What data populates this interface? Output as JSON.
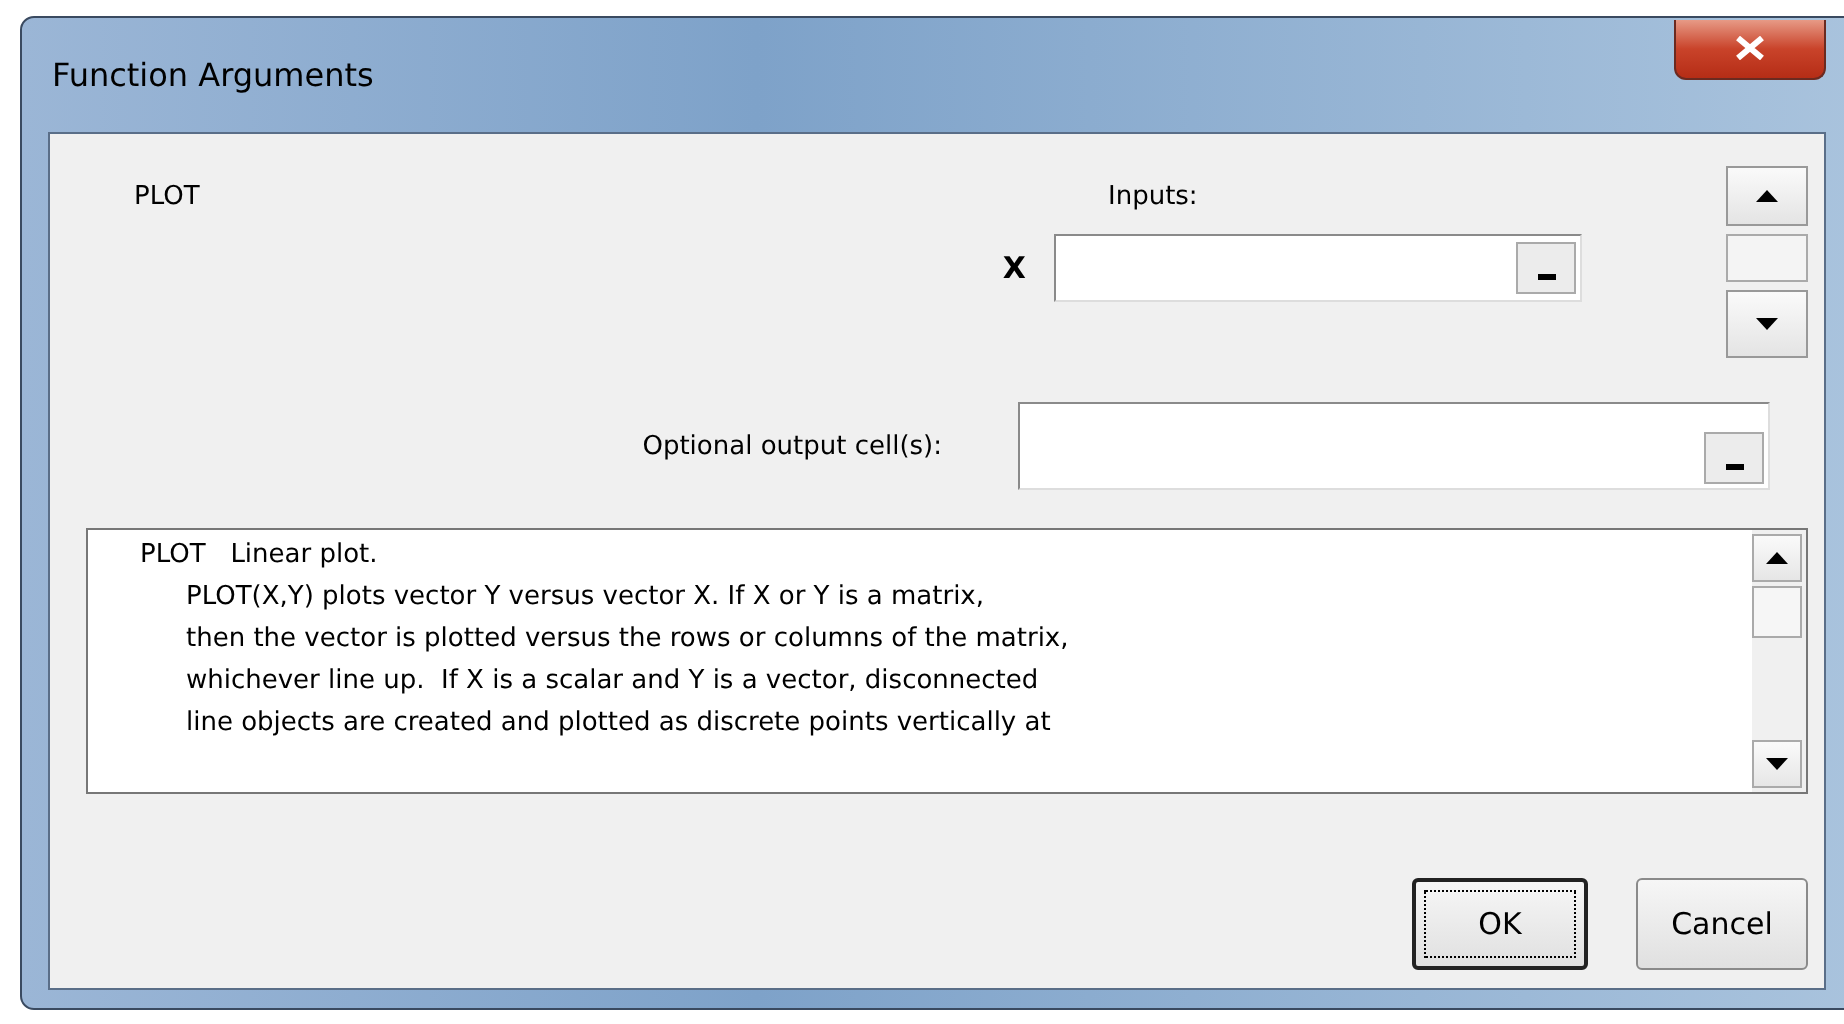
{
  "window": {
    "title": "Function Arguments"
  },
  "function_name": "PLOT",
  "inputs_label": "Inputs:",
  "arguments": [
    {
      "label": "X"
    }
  ],
  "optional_output": {
    "label": "Optional output cell(s):"
  },
  "description": {
    "heading": "PLOT   Linear plot.",
    "lines": [
      "PLOT(X,Y) plots vector Y versus vector X. If X or Y is a matrix,",
      "then the vector is plotted versus the rows or columns of the matrix,",
      "whichever line up.  If X is a scalar and Y is a vector, disconnected",
      "line objects are created and plotted as discrete points vertically at"
    ]
  },
  "buttons": [
    {
      "label": "OK",
      "default": true
    },
    {
      "label": "Cancel",
      "default": false
    }
  ]
}
